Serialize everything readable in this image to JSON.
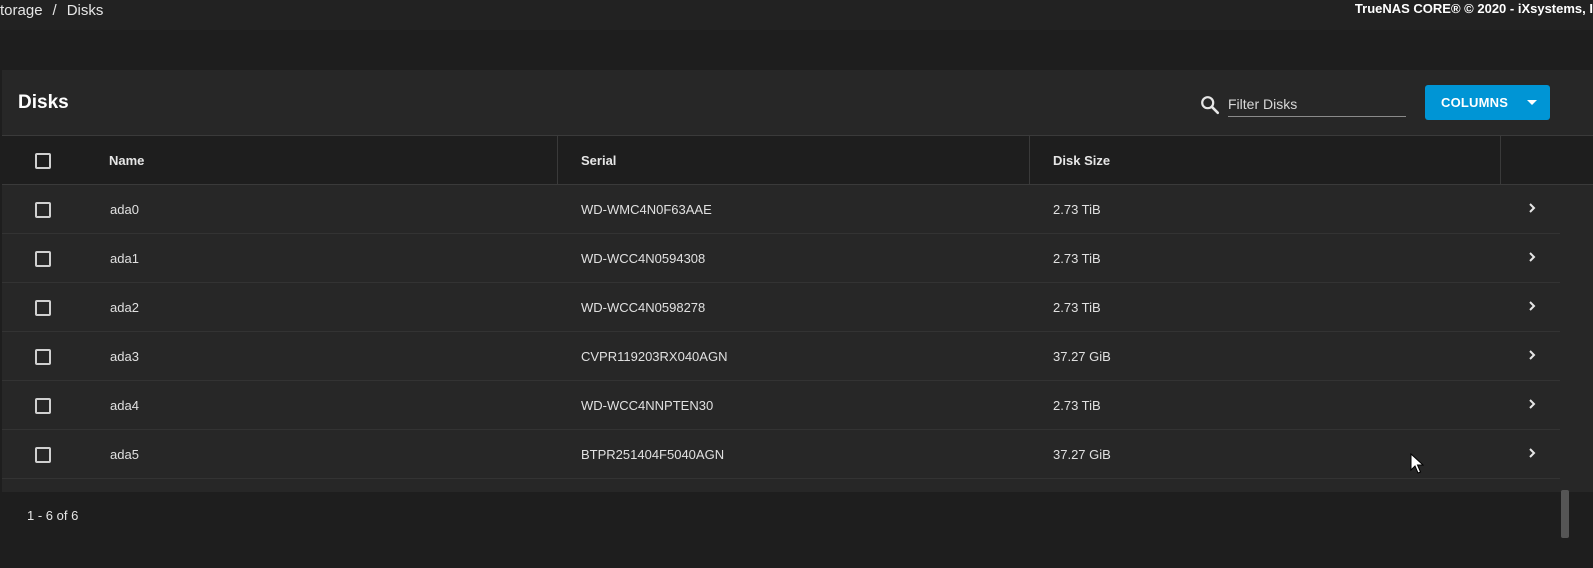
{
  "breadcrumb": {
    "parent": "torage",
    "separator": "/",
    "current": "Disks"
  },
  "copyright": "TrueNAS CORE® © 2020 - iXsystems, I",
  "card": {
    "title": "Disks",
    "search": {
      "placeholder": "Filter Disks",
      "value": ""
    },
    "columns_button": "COLUMNS"
  },
  "table": {
    "headers": {
      "name": "Name",
      "serial": "Serial",
      "disk_size": "Disk Size"
    },
    "rows": [
      {
        "name": "ada0",
        "serial": "WD-WMC4N0F63AAE",
        "disk_size": "2.73 TiB"
      },
      {
        "name": "ada1",
        "serial": "WD-WCC4N0594308",
        "disk_size": "2.73 TiB"
      },
      {
        "name": "ada2",
        "serial": "WD-WCC4N0598278",
        "disk_size": "2.73 TiB"
      },
      {
        "name": "ada3",
        "serial": "CVPR119203RX040AGN",
        "disk_size": "37.27 GiB"
      },
      {
        "name": "ada4",
        "serial": "WD-WCC4NNPTEN30",
        "disk_size": "2.73 TiB"
      },
      {
        "name": "ada5",
        "serial": "BTPR251404F5040AGN",
        "disk_size": "37.27 GiB"
      }
    ]
  },
  "paginator": "1 - 6 of 6",
  "icons": {
    "search": "search-icon",
    "caret": "caret-down-icon",
    "chevron": "chevron-right-icon",
    "cursor": "mouse-cursor-icon"
  },
  "colors": {
    "accent": "#0095d5",
    "background": "#1e1e1e",
    "card": "#272727"
  }
}
